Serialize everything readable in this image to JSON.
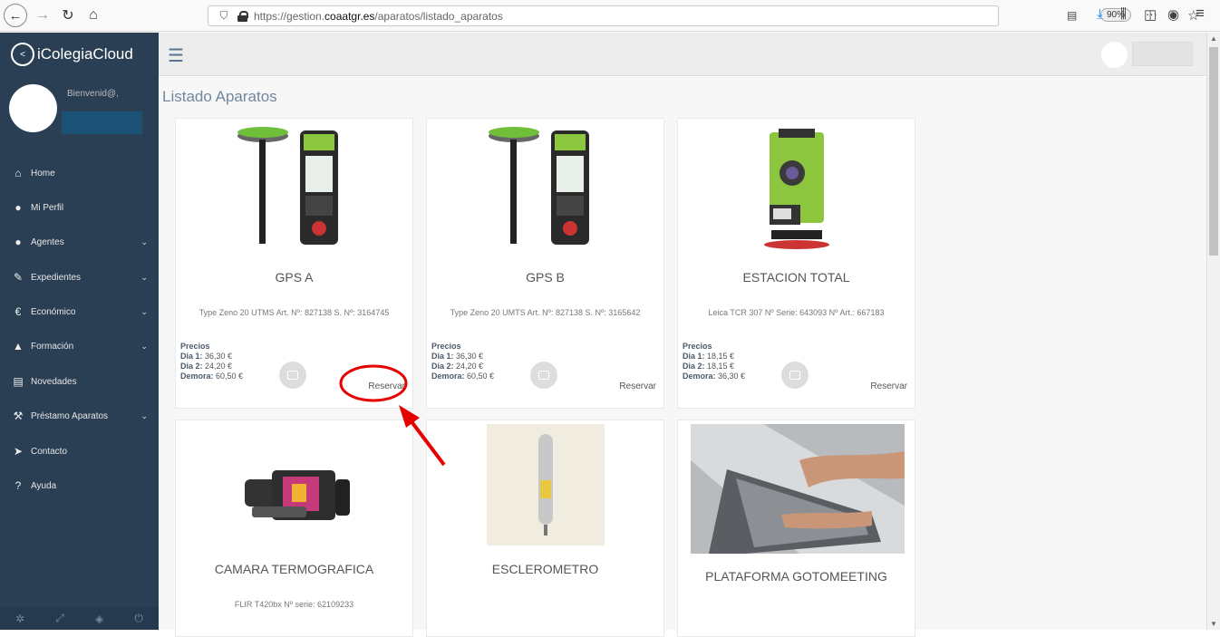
{
  "browser": {
    "url_prefix": "https://gestion.",
    "url_domain": "coaatgr.es",
    "url_path": "/aparatos/listado_aparatos",
    "zoom": "90%",
    "more": "···"
  },
  "sidebar": {
    "brand": "iColegiaCloud",
    "welcome": "Bienvenid@,",
    "items": [
      {
        "label": "Home",
        "icon": "home-icon",
        "glyph": "⌂",
        "chevron": ""
      },
      {
        "label": "Mi Perfil",
        "icon": "user-icon",
        "glyph": "●",
        "chevron": ""
      },
      {
        "label": "Agentes",
        "icon": "users-icon",
        "glyph": "●",
        "chevron": "⌄"
      },
      {
        "label": "Expedientes",
        "icon": "edit-icon",
        "glyph": "✎",
        "chevron": "⌄"
      },
      {
        "label": "Económico",
        "icon": "euro-icon",
        "glyph": "€",
        "chevron": "⌄"
      },
      {
        "label": "Formación",
        "icon": "graduation-cap-icon",
        "glyph": "▲",
        "chevron": "⌄"
      },
      {
        "label": "Novedades",
        "icon": "newspaper-icon",
        "glyph": "▤",
        "chevron": ""
      },
      {
        "label": "Préstamo Aparatos",
        "icon": "wrench-icon",
        "glyph": "⚒",
        "chevron": "⌄"
      },
      {
        "label": "Contacto",
        "icon": "send-icon",
        "glyph": "➤",
        "chevron": ""
      },
      {
        "label": "Ayuda",
        "icon": "question-icon",
        "glyph": "?",
        "chevron": ""
      }
    ]
  },
  "main": {
    "title": "Listado Aparatos",
    "cards": [
      {
        "name": "GPS A",
        "desc": "Type Zeno 20 UTMS Art. Nº: 827138 S. Nº: 3164745",
        "prices_label": "Precios",
        "dia1_label": "Dia 1:",
        "dia1": "36,30 €",
        "dia2_label": "Dia 2:",
        "dia2": "24,20 €",
        "demora_label": "Demora:",
        "demora": "60,50 €",
        "reservar": "Reservar"
      },
      {
        "name": "GPS B",
        "desc": "Type Zeno 20 UMTS Art. Nº: 827138 S. Nº: 3165642",
        "prices_label": "Precios",
        "dia1_label": "Dia 1:",
        "dia1": "36,30 €",
        "dia2_label": "Dia 2:",
        "dia2": "24,20 €",
        "demora_label": "Demora:",
        "demora": "60,50 €",
        "reservar": "Reservar"
      },
      {
        "name": "ESTACION TOTAL",
        "desc": "Leica TCR 307 Nº Serie: 643093 Nº Art.: 667183",
        "prices_label": "Precios",
        "dia1_label": "Dia 1:",
        "dia1": "18,15 €",
        "dia2_label": "Dia 2:",
        "dia2": "18,15 €",
        "demora_label": "Demora:",
        "demora": "36,30 €",
        "reservar": "Reservar"
      },
      {
        "name": "CAMARA TERMOGRAFICA",
        "desc": "FLIR T420bx Nº serie: 62109233"
      },
      {
        "name": "ESCLEROMETRO",
        "desc": ""
      },
      {
        "name": "PLATAFORMA GOTOMEETING",
        "desc": ""
      }
    ]
  },
  "colors": {
    "sidebar_bg": "#2a3f54",
    "annotation": "#e60000"
  }
}
